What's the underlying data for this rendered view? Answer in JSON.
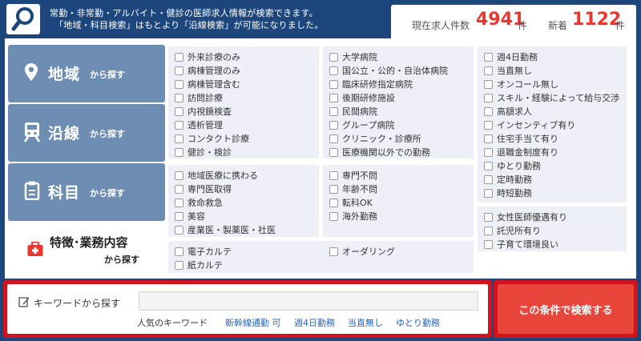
{
  "header": {
    "line1": "常勤・非常勤・アルバイト・健診の医師求人情報が検索できます。",
    "line2": "「地域・科目検索」はもとより「沿線検索」が可能になりました。",
    "current_label": "現在求人件数",
    "current_count": "4941",
    "current_unit": "件",
    "new_label": "新着",
    "new_count": "1122",
    "new_unit": "件"
  },
  "tabs": [
    {
      "title": "地域",
      "sub": "から探す",
      "icon": "map-pin-icon"
    },
    {
      "title": "沿線",
      "sub": "から探す",
      "icon": "train-icon"
    },
    {
      "title": "科目",
      "sub": "から探す",
      "icon": "clipboard-icon"
    },
    {
      "title": "特徴･業務内容",
      "sub": "から探す",
      "icon": "medical-bag-icon"
    }
  ],
  "groups": {
    "g1": [
      "外来診療のみ",
      "病棟管理のみ",
      "病棟管理含む",
      "訪問診療",
      "内視鏡検査",
      "透析管理",
      "コンタクト診療",
      "健診・検診"
    ],
    "g2": [
      "大学病院",
      "国公立・公的・自治体病院",
      "臨床研修指定病院",
      "後期研修施設",
      "民間病院",
      "グループ病院",
      "クリニック・診療所",
      "医療機関以外での勤務"
    ],
    "g3": [
      "週4日勤務",
      "当直無し",
      "オンコール無し",
      "スキル・経験によって給与交渉",
      "高額求人",
      "インセンティブ有り",
      "住宅手当て有り",
      "退職金制度有り",
      "ゆとり勤務",
      "定時勤務",
      "時短勤務"
    ],
    "g4": [
      "地域医療に携わる",
      "専門医取得",
      "救命救急",
      "美容",
      "産業医・製薬医・社医"
    ],
    "g5": [
      "専門不問",
      "年齢不問",
      "転科OK",
      "海外勤務"
    ],
    "g6": [
      "女性医師優遇有り",
      "託児所有り",
      "子育て環境良い"
    ],
    "g7a": [
      "電子カルテ",
      "紙カルテ"
    ],
    "g7b": [
      "オーダリング"
    ]
  },
  "keyword": {
    "label": "キーワードから探す",
    "value": "",
    "popular_label": "人気のキーワード",
    "popular": [
      "新幹線通勤 可",
      "週4日勤務",
      "当直無し",
      "ゆとり勤務"
    ]
  },
  "search_button": "この条件で検索する",
  "colors": {
    "navy": "#1c467c",
    "tab": "#6d8db3",
    "accent": "#e8382f",
    "panel": "#edf1f7"
  }
}
